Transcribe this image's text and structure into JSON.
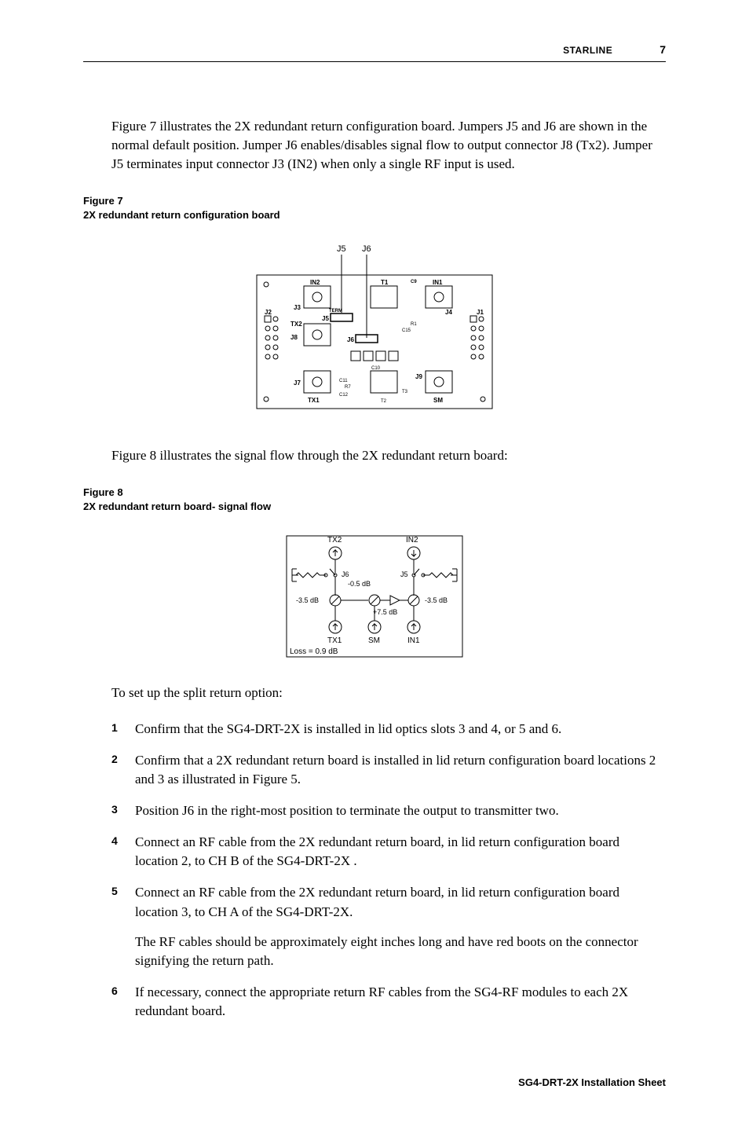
{
  "header": {
    "brand": "STARLINE",
    "page_no": "7"
  },
  "paragraphs": {
    "p1_a": "Figure 7 illustrates the 2X redundant return configuration board. Jumpers ",
    "p1_b": " and ",
    "p1_c": " are shown in the normal default position. Jumper ",
    "p1_d": " enables/disables signal flow to output connector ",
    "p1_e": " (Tx2). Jumper ",
    "p1_f": " terminates input connector ",
    "p1_g": " (",
    "p1_h": ") when only a single RF input is used.",
    "j5": "J5",
    "j6": "J6",
    "j8": "J8",
    "j3": "J3",
    "in2": "IN2",
    "p2": "Figure 8 illustrates the signal flow through the 2X redundant return board:",
    "intro": "To set up the split return option:"
  },
  "fig7_caption_line1": "Figure  7",
  "fig7_caption_line2": "2X redundant return configuration board",
  "fig8_caption_line1": "Figure  8",
  "fig8_caption_line2": "2X redundant return board- signal flow",
  "fig7_labels": {
    "J5_top": "J5",
    "J6_top": "J6",
    "IN2": "IN2",
    "T1": "T1",
    "IN1": "IN1",
    "J3": "J3",
    "TERM": "TERM",
    "J4": "J4",
    "J1": "J1",
    "J2": "J2",
    "TX2": "TX2",
    "J5": "J5",
    "J8": "J8",
    "J6": "J6",
    "J7": "J7",
    "TX1": "TX1",
    "SM": "SM",
    "J9": "J9",
    "C9": "C9",
    "C10": "C10",
    "C11": "C11",
    "C12": "C12",
    "C15": "C15",
    "R1": "R1",
    "R7": "R7",
    "T2": "T2",
    "T3": "T3"
  },
  "fig8_labels": {
    "TX2": "TX2",
    "IN2": "IN2",
    "J6": "J6",
    "J5": "J5",
    "m05": "-0.5 dB",
    "m35a": "-3.5 dB",
    "m35b": "-3.5 dB",
    "p75": "+7.5 dB",
    "TX1": "TX1",
    "SM": "SM",
    "IN1": "IN1",
    "loss": "Loss = 0.9 dB"
  },
  "steps": [
    "Confirm that the SG4-DRT-2X is installed in lid optics slots 3 and 4, or 5 and 6.",
    "Confirm that a 2X redundant return board is installed in lid return configuration board locations 2 and 3 as illustrated in Figure 5.",
    "Position J6 in the right-most position to terminate the output to transmitter two.",
    "Connect an RF cable from the 2X redundant return board, in lid return configuration board location 2, to CH B of the SG4-DRT-2X .",
    "Connect an RF cable from the 2X redundant return board, in lid return configuration board location 3, to CH A of the SG4-DRT-2X."
  ],
  "step5_extra": "The RF cables should be approximately eight inches long and have red boots on the connector signifying the return path.",
  "step6": "If necessary, connect the appropriate return RF cables from the SG4-RF modules to each 2X redundant board.",
  "footer": "SG4-DRT-2X Installation Sheet"
}
